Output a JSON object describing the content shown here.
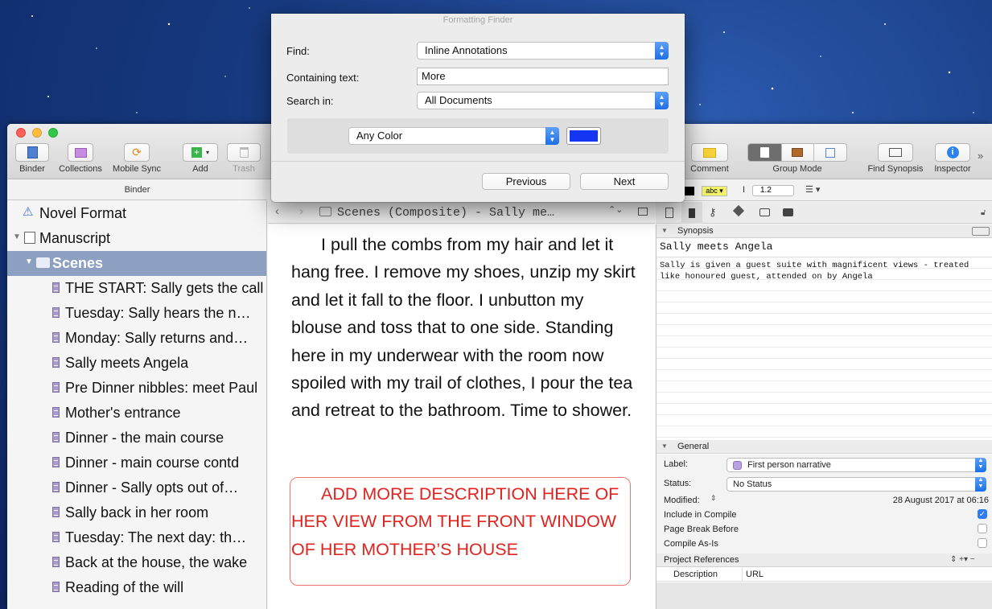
{
  "dialog": {
    "title": "Formatting Finder",
    "find_label": "Find:",
    "find_value": "Inline Annotations",
    "containing_label": "Containing text:",
    "containing_value": "More",
    "search_in_label": "Search in:",
    "search_in_value": "All Documents",
    "color_value": "Any Color",
    "swatch_color": "#1436f2",
    "previous": "Previous",
    "next": "Next"
  },
  "toolbar": {
    "binder": "Binder",
    "collections": "Collections",
    "mobile_sync": "Mobile Sync",
    "add": "Add",
    "trash": "Trash",
    "comment": "Comment",
    "group_mode": "Group Mode",
    "find_synopsis": "Find Synopsis",
    "inspector": "Inspector"
  },
  "binder": {
    "header": "Binder",
    "items": [
      {
        "label": "Novel Format"
      },
      {
        "label": "Manuscript"
      },
      {
        "label": "Scenes"
      },
      {
        "label": "THE START: Sally gets the call"
      },
      {
        "label": "Tuesday: Sally hears the n…"
      },
      {
        "label": "Monday: Sally returns and…"
      },
      {
        "label": "Sally meets Angela"
      },
      {
        "label": "Pre Dinner nibbles: meet Paul"
      },
      {
        "label": "Mother's entrance"
      },
      {
        "label": "Dinner - the main course"
      },
      {
        "label": "Dinner - main course contd"
      },
      {
        "label": "Dinner - Sally opts out of…"
      },
      {
        "label": "Sally back in her room"
      },
      {
        "label": "Tuesday: The next day: th…"
      },
      {
        "label": "Back at the house, the wake"
      },
      {
        "label": "Reading of the will"
      }
    ]
  },
  "editor": {
    "header_title": "Scenes (Composite) - Sally me…",
    "body": "I pull the combs from my hair and let it hang free. I remove my shoes, unzip my skirt and let it fall to the floor. I unbutton my blouse and toss that to one side. Standing here in my underwear with the room now spoiled with my trail of clothes, I pour the tea and retreat to the bathroom. Time to shower.",
    "annotation": "ADD MORE DESCRIPTION HERE OF HER VIEW FROM THE FRONT WINDOW OF HER MOTHER’S HOUSE",
    "annotation_color": "#e0231e"
  },
  "format_bar": {
    "highlight": "abc",
    "line_spacing": "1.2"
  },
  "inspector": {
    "synopsis_header": "Synopsis",
    "synopsis_title": "Sally meets Angela",
    "synopsis_text": "Sally is given a guest suite with magnificent views - treated like honoured guest, attended on by Angela",
    "general_header": "General",
    "label_label": "Label:",
    "label_value": "First person narrative",
    "label_color": "#b9a2e0",
    "status_label": "Status:",
    "status_value": "No Status",
    "modified_label": "Modified:",
    "modified_value": "28 August 2017 at 06:16",
    "include_compile": "Include in Compile",
    "page_break": "Page Break Before",
    "compile_as_is": "Compile As-Is",
    "refs_header": "Project References",
    "col_description": "Description",
    "col_url": "URL"
  }
}
